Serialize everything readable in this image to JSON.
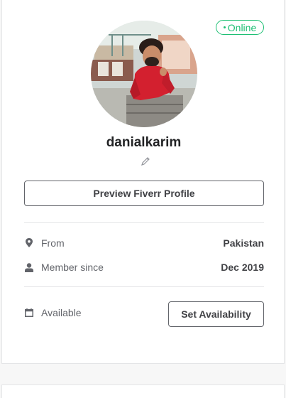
{
  "profile": {
    "status": "Online",
    "username": "danialkarim",
    "preview_button": "Preview Fiverr Profile"
  },
  "info": {
    "from_label": "From",
    "from_value": "Pakistan",
    "member_label": "Member since",
    "member_value": "Dec 2019"
  },
  "availability": {
    "label": "Available",
    "button": "Set Availability"
  },
  "colors": {
    "accent": "#1dbf73",
    "text": "#404145",
    "border": "#e4e5e7"
  },
  "icons": {
    "edit": "pencil-icon",
    "location": "map-pin-icon",
    "member": "user-icon",
    "calendar": "calendar-icon"
  }
}
